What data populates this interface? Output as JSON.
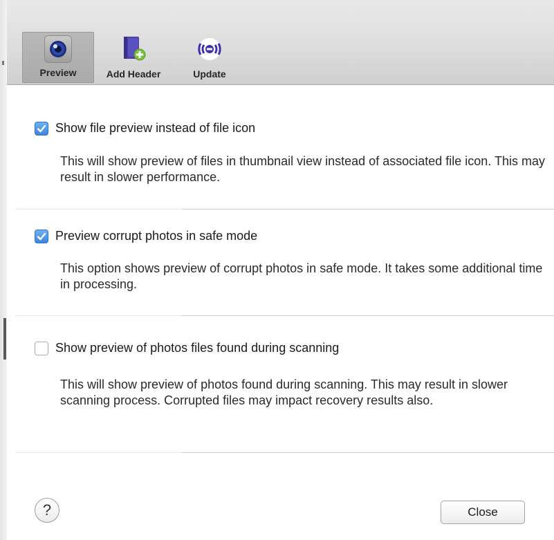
{
  "toolbar": {
    "items": [
      {
        "label": "Preview",
        "icon": "preview-eye-icon",
        "selected": true
      },
      {
        "label": "Add Header",
        "icon": "add-header-book-icon",
        "selected": false
      },
      {
        "label": "Update",
        "icon": "update-radar-icon",
        "selected": false
      }
    ]
  },
  "options": [
    {
      "label": "Show file preview instead of file icon",
      "checked": true,
      "description": "This will show preview of files in thumbnail view instead of associated file icon. This may result in slower performance."
    },
    {
      "label": "Preview corrupt photos in safe mode",
      "checked": true,
      "description": "This option shows preview of corrupt photos in safe mode. It takes some additional time in processing."
    },
    {
      "label": "Show preview of photos files found during scanning",
      "checked": false,
      "description": "This will show preview of photos found during scanning. This may result in slower scanning process. Corrupted files may impact recovery results also."
    }
  ],
  "footer": {
    "help_label": "?",
    "close_label": "Close"
  },
  "colors": {
    "checkbox_accent": "#3d86e0",
    "add_icon_green": "#7ac142",
    "book_purple": "#4b3fa8"
  }
}
